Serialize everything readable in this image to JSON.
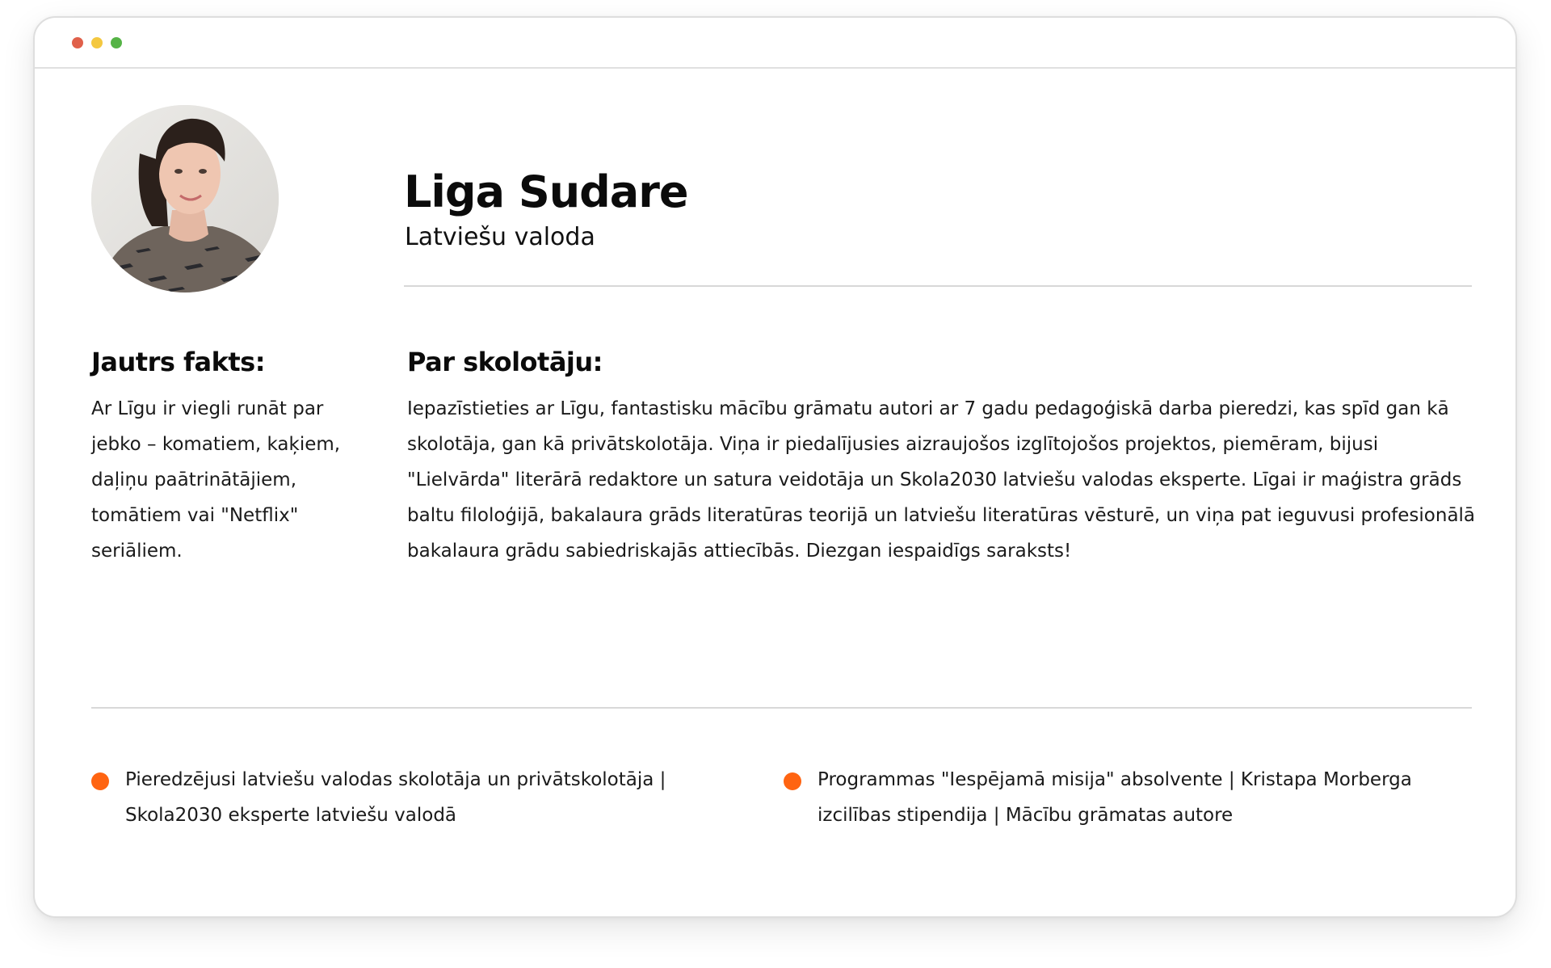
{
  "window": {
    "controls": [
      "close",
      "minimize",
      "maximize"
    ]
  },
  "teacher": {
    "photo_alt": "Liga Sudare",
    "name": "Liga Sudare",
    "subject": "Latviešu valoda"
  },
  "fun_fact": {
    "heading": "Jautrs fakts:",
    "text": "Ar Līgu ir viegli runāt par jebko – komatiem, kaķiem, daļiņu paātrinātājiem, tomātiem vai \"Netflix\" seriāliem."
  },
  "about": {
    "heading": "Par skolotāju:",
    "text": "Iepazīstieties ar Līgu, fantastisku mācību grāmatu autori ar 7 gadu pedagoģiskā darba pieredzi, kas spīd gan kā skolotāja, gan kā privātskolotāja. Viņa ir piedalījusies aizraujošos izglītojošos projektos, piemēram, bijusi \"Lielvārda\" literārā redaktore un satura veidotāja un Skola2030 latviešu valodas eksperte. Līgai ir maģistra grāds baltu filoloģijā, bakalaura grāds literatūras teorijā un latviešu literatūras vēsturē, un viņa pat ieguvusi profesionālā bakalaura grādu sabiedriskajās attiecībās. Diezgan iespaidīgs saraksts!"
  },
  "highlights": [
    {
      "text": "Pieredzējusi latviešu valodas skolotāja un privātskolotāja | Skola2030 eksperte latviešu valodā"
    },
    {
      "text": "Programmas \"Iespējamā misija\" absolvente | Kristapa Morberga izcilības stipendija | Mācību grāmatas autore"
    }
  ],
  "colors": {
    "accent": "#ff6411",
    "divider": "#d8d8d8",
    "text": "#111111",
    "dot_red": "#e0604a",
    "dot_yellow": "#f4c840",
    "dot_green": "#55b346"
  }
}
